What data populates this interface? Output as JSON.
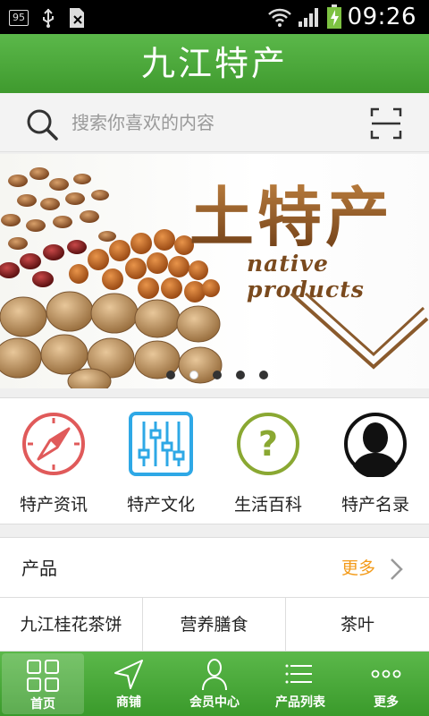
{
  "status_bar": {
    "badge": "95",
    "time": "09:26"
  },
  "header": {
    "title": "九江特产"
  },
  "search": {
    "placeholder": "搜索你喜欢的内容"
  },
  "banner": {
    "headline": "土特产",
    "subtitle": "native products",
    "slide_count": 5,
    "active_slide": 1
  },
  "categories": [
    {
      "label": "特产资讯",
      "icon": "compass-icon",
      "color": "#e05a5a"
    },
    {
      "label": "特产文化",
      "icon": "sliders-icon",
      "color": "#2ea8e6"
    },
    {
      "label": "生活百科",
      "icon": "question-icon",
      "color": "#8aa832"
    },
    {
      "label": "特产名录",
      "icon": "person-silhouette-icon",
      "color": "#111111"
    }
  ],
  "products": {
    "title": "产品",
    "more_label": "更多",
    "items": [
      "九江桂花茶饼",
      "营养膳食",
      "茶叶"
    ]
  },
  "bottom_nav": [
    {
      "label": "首页",
      "icon": "grid-icon",
      "active": true
    },
    {
      "label": "商铺",
      "icon": "navigation-arrow-icon",
      "active": false
    },
    {
      "label": "会员中心",
      "icon": "user-icon",
      "active": false
    },
    {
      "label": "产品列表",
      "icon": "list-icon",
      "active": false
    },
    {
      "label": "更多",
      "icon": "more-dots-icon",
      "active": false
    }
  ],
  "colors": {
    "brand_green": "#4caf3d",
    "accent_orange": "#f39b1a"
  }
}
